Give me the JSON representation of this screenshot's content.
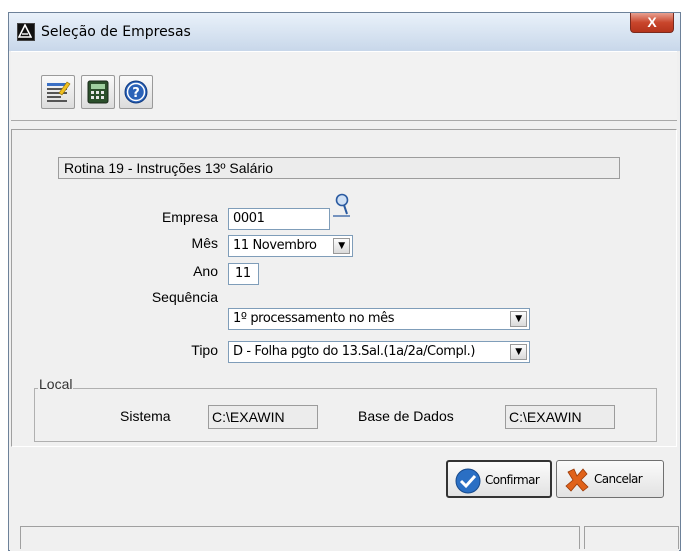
{
  "window": {
    "title": "Seleção de Empresas",
    "close_glyph": "X"
  },
  "toolbar": {
    "buttons": [
      "edit-icon",
      "calculator-icon",
      "help-icon"
    ]
  },
  "routine": {
    "text": "Rotina 19 - Instruções 13º Salário"
  },
  "form": {
    "empresa": {
      "label": "Empresa",
      "value": "0001"
    },
    "mes": {
      "label": "Mês",
      "value": "11 Novembro"
    },
    "ano": {
      "label": "Ano",
      "value": "11"
    },
    "sequencia": {
      "label": "Sequência",
      "value": "1º processamento no mês"
    },
    "tipo": {
      "label": "Tipo",
      "value": "D - Folha pgto do 13.Sal.(1a/2a/Compl.)"
    }
  },
  "local": {
    "title": "Local",
    "sistema_label": "Sistema",
    "sistema_value": "C:\\EXAWIN",
    "base_label": "Base de Dados",
    "base_value": "C:\\EXAWIN"
  },
  "buttons": {
    "confirm": "Confirmar",
    "cancel": "Cancelar"
  },
  "colors": {
    "titlebar": "#d7e3f1",
    "close": "#c9462c",
    "confirm_icon": "#2a6fc4",
    "cancel_icon": "#e0621a"
  }
}
